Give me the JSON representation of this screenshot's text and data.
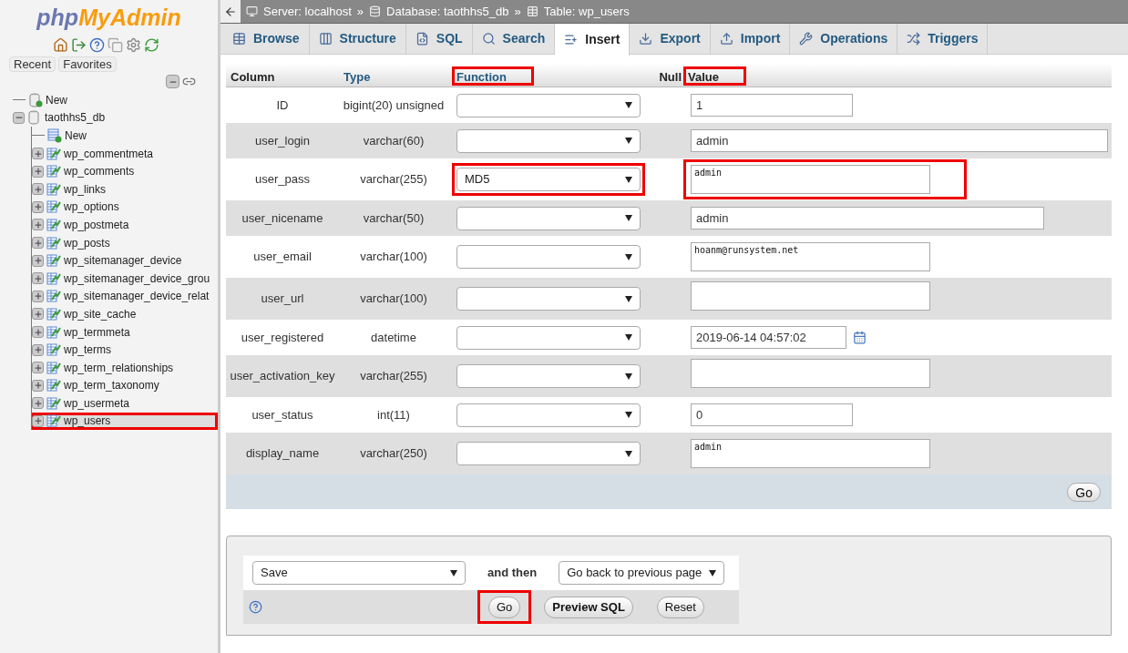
{
  "sidebar": {
    "logo": {
      "first": "php",
      "second": "MyAdmin"
    },
    "buttons": [
      "Recent",
      "Favorites"
    ],
    "tree": [
      {
        "kind": "new",
        "label": "New"
      },
      {
        "kind": "database",
        "label": "taothhs5_db",
        "expanded": true,
        "children": [
          {
            "kind": "new",
            "label": "New"
          },
          {
            "kind": "table",
            "label": "wp_commentmeta",
            "expanded": false,
            "selected": false,
            "highlighted": false
          },
          {
            "kind": "table",
            "label": "wp_comments",
            "expanded": false,
            "selected": false,
            "highlighted": false
          },
          {
            "kind": "table",
            "label": "wp_links",
            "expanded": false,
            "selected": false,
            "highlighted": false
          },
          {
            "kind": "table",
            "label": "wp_options",
            "expanded": false,
            "selected": false,
            "highlighted": false
          },
          {
            "kind": "table",
            "label": "wp_postmeta",
            "expanded": false,
            "selected": false,
            "highlighted": false
          },
          {
            "kind": "table",
            "label": "wp_posts",
            "expanded": false,
            "selected": false,
            "highlighted": false
          },
          {
            "kind": "table",
            "label": "wp_sitemanager_device",
            "expanded": false,
            "selected": false,
            "highlighted": false
          },
          {
            "kind": "table",
            "label": "wp_sitemanager_device_grou",
            "expanded": false,
            "selected": false,
            "highlighted": false
          },
          {
            "kind": "table",
            "label": "wp_sitemanager_device_relat",
            "expanded": false,
            "selected": false,
            "highlighted": false
          },
          {
            "kind": "table",
            "label": "wp_site_cache",
            "expanded": false,
            "selected": false,
            "highlighted": false
          },
          {
            "kind": "table",
            "label": "wp_termmeta",
            "expanded": false,
            "selected": false,
            "highlighted": false
          },
          {
            "kind": "table",
            "label": "wp_terms",
            "expanded": false,
            "selected": false,
            "highlighted": false
          },
          {
            "kind": "table",
            "label": "wp_term_relationships",
            "expanded": false,
            "selected": false,
            "highlighted": false
          },
          {
            "kind": "table",
            "label": "wp_term_taxonomy",
            "expanded": false,
            "selected": false,
            "highlighted": false
          },
          {
            "kind": "table",
            "label": "wp_usermeta",
            "expanded": false,
            "selected": false,
            "highlighted": false
          },
          {
            "kind": "table",
            "label": "wp_users",
            "expanded": false,
            "selected": true,
            "highlighted": true
          }
        ]
      }
    ]
  },
  "breadcrumb": {
    "separator": "»",
    "items": [
      {
        "kind": "server",
        "label": "Server: localhost"
      },
      {
        "kind": "database",
        "label": "Database: taothhs5_db"
      },
      {
        "kind": "table",
        "label": "Table: wp_users"
      }
    ]
  },
  "tabs": [
    {
      "kind": "browse",
      "label": "Browse",
      "selected": false
    },
    {
      "kind": "structure",
      "label": "Structure",
      "selected": false
    },
    {
      "kind": "sql",
      "label": "SQL",
      "selected": false
    },
    {
      "kind": "search",
      "label": "Search",
      "selected": false
    },
    {
      "kind": "insert",
      "label": "Insert",
      "selected": true
    },
    {
      "kind": "export",
      "label": "Export",
      "selected": false
    },
    {
      "kind": "import",
      "label": "Import",
      "selected": false
    },
    {
      "kind": "operations",
      "label": "Operations",
      "selected": false
    },
    {
      "kind": "triggers",
      "label": "Triggers",
      "selected": false
    }
  ],
  "table": {
    "columns": [
      {
        "label": "Column",
        "highlighted": false
      },
      {
        "label": "Type",
        "highlighted": false
      },
      {
        "label": "Function",
        "highlighted": true
      },
      {
        "label": "Null",
        "highlighted": false
      },
      {
        "label": "Value",
        "highlighted": true
      }
    ],
    "rows": [
      {
        "column": "ID",
        "type": "bigint(20) unsigned",
        "kind": "short",
        "value": "1",
        "highlighted": false
      },
      {
        "column": "user_login",
        "type": "varchar(60)",
        "kind": "long",
        "value": "admin",
        "highlighted": false
      },
      {
        "column": "user_pass",
        "type": "varchar(255)",
        "function": "MD5",
        "kind": "textarea",
        "value": "admin",
        "highlighted": true
      },
      {
        "column": "user_nicename",
        "type": "varchar(50)",
        "kind": "medium",
        "value": "admin",
        "highlighted": false
      },
      {
        "column": "user_email",
        "type": "varchar(100)",
        "kind": "textarea",
        "value": "hoanm@runsystem.net",
        "highlighted": false
      },
      {
        "column": "user_url",
        "type": "varchar(100)",
        "kind": "textarea",
        "highlighted": false
      },
      {
        "column": "user_registered",
        "type": "datetime",
        "kind": "date",
        "value": "2019-06-14 04:57:02",
        "highlighted": false
      },
      {
        "column": "user_activation_key",
        "type": "varchar(255)",
        "kind": "textarea",
        "highlighted": false
      },
      {
        "column": "user_status",
        "type": "int(11)",
        "kind": "short",
        "value": "0",
        "highlighted": false
      },
      {
        "column": "display_name",
        "type": "varchar(250)",
        "kind": "textarea",
        "value": "admin",
        "highlighted": false
      }
    ],
    "go": "Go"
  },
  "footer": {
    "action": "Save",
    "and_then": "and then",
    "after": "Go back to previous page",
    "buttons": [
      {
        "label": "Go",
        "highlighted": true
      },
      {
        "label": "Preview SQL",
        "highlighted": false
      },
      {
        "label": "Reset",
        "highlighted": false
      }
    ]
  }
}
